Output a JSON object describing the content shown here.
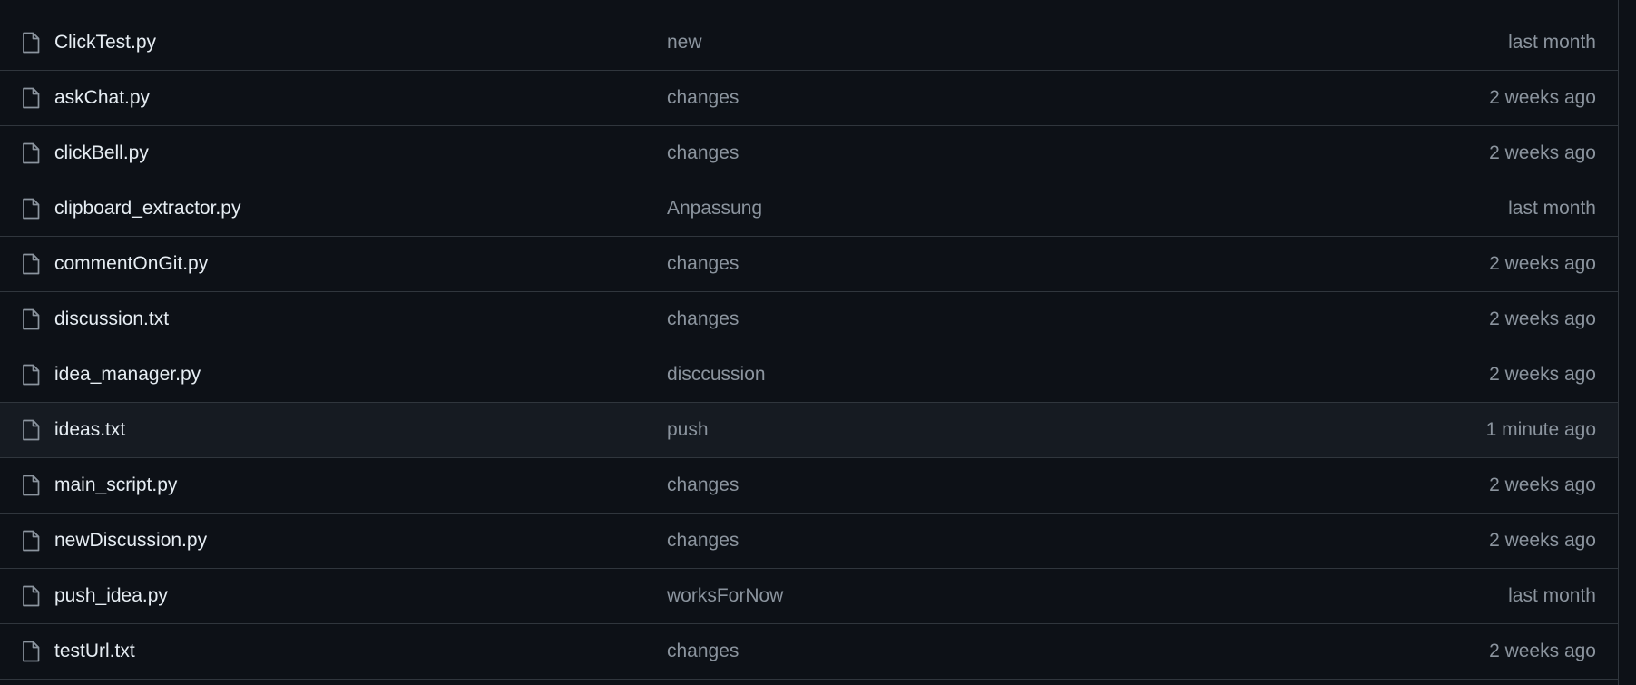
{
  "files": [
    {
      "name": "ClickTest.py",
      "message": "new",
      "time": "last month",
      "icon": "file-icon"
    },
    {
      "name": "askChat.py",
      "message": "changes",
      "time": "2 weeks ago",
      "icon": "file-icon"
    },
    {
      "name": "clickBell.py",
      "message": "changes",
      "time": "2 weeks ago",
      "icon": "file-icon"
    },
    {
      "name": "clipboard_extractor.py",
      "message": "Anpassung",
      "time": "last month",
      "icon": "file-icon"
    },
    {
      "name": "commentOnGit.py",
      "message": "changes",
      "time": "2 weeks ago",
      "icon": "file-icon"
    },
    {
      "name": "discussion.txt",
      "message": "changes",
      "time": "2 weeks ago",
      "icon": "file-icon"
    },
    {
      "name": "idea_manager.py",
      "message": "disccussion",
      "time": "2 weeks ago",
      "icon": "file-icon"
    },
    {
      "name": "ideas.txt",
      "message": "push",
      "time": "1 minute ago",
      "icon": "file-icon"
    },
    {
      "name": "main_script.py",
      "message": "changes",
      "time": "2 weeks ago",
      "icon": "file-icon"
    },
    {
      "name": "newDiscussion.py",
      "message": "changes",
      "time": "2 weeks ago",
      "icon": "file-icon"
    },
    {
      "name": "push_idea.py",
      "message": "worksForNow",
      "time": "last month",
      "icon": "file-icon"
    },
    {
      "name": "testUrl.txt",
      "message": "changes",
      "time": "2 weeks ago",
      "icon": "file-icon"
    }
  ],
  "colors": {
    "background": "#0d1117",
    "row_highlight": "#161b22",
    "border": "#30363d",
    "file_name": "#e6edf3",
    "muted": "#8b949e"
  }
}
